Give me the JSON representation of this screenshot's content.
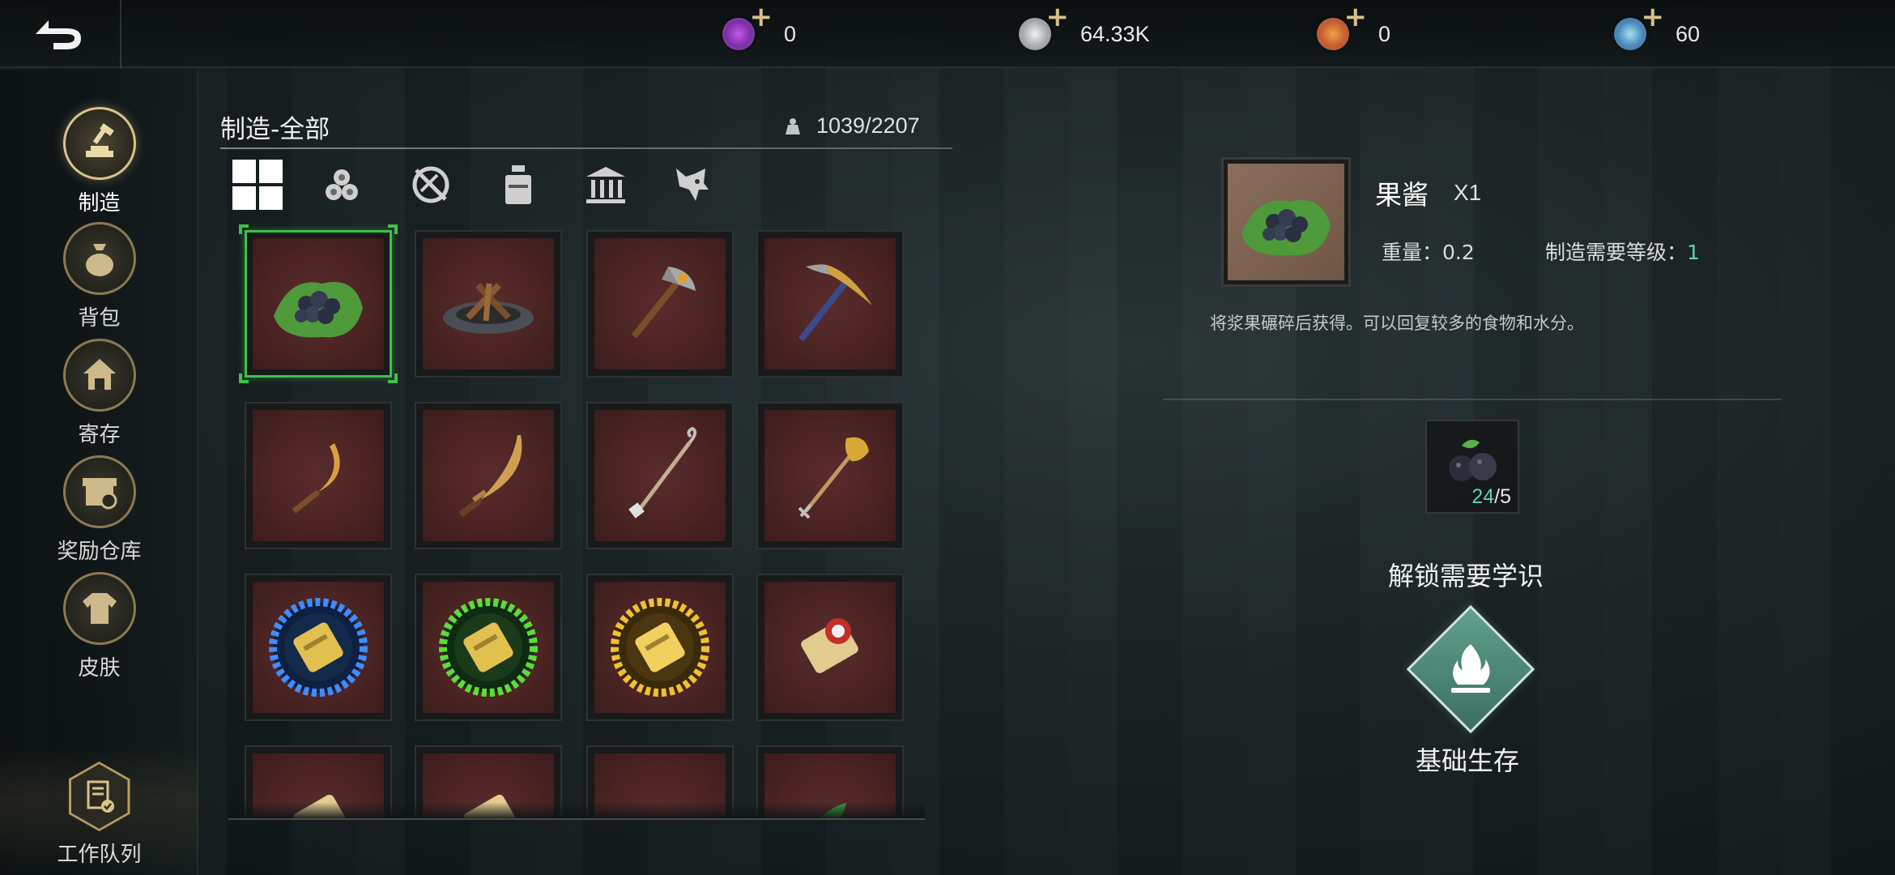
{
  "colors": {
    "accent_gold": "#d8c489",
    "selected_green": "#3bc24a",
    "value_teal": "#5fd1b3",
    "slot_red": "#4a2323"
  },
  "top_bar": {
    "back_icon": "back-arrow-icon",
    "currencies": [
      {
        "icon": "purple-gem-coin-icon",
        "color": "#7b2fb0",
        "amount": "0"
      },
      {
        "icon": "silver-coin-icon",
        "color": "#b9bdc0",
        "amount": "64.33K"
      },
      {
        "icon": "red-gold-coin-icon",
        "color": "#c0552a",
        "amount": "0"
      },
      {
        "icon": "blue-gem-coin-icon",
        "color": "#3f7fb5",
        "amount": "60"
      }
    ]
  },
  "sidebar": {
    "items": [
      {
        "label": "制造",
        "icon": "hammer-anvil-icon",
        "active": true
      },
      {
        "label": "背包",
        "icon": "bag-icon",
        "active": false
      },
      {
        "label": "寄存",
        "icon": "house-storage-icon",
        "active": false
      },
      {
        "label": "奖励仓库",
        "icon": "shop-reward-icon",
        "active": false
      },
      {
        "label": "皮肤",
        "icon": "shirt-skin-icon",
        "active": false
      }
    ],
    "queue": {
      "label": "工作队列",
      "icon": "document-check-icon"
    }
  },
  "crafting": {
    "title": "制造-全部",
    "capacity": "1039/2207",
    "capacity_icon": "weight-icon",
    "categories": [
      {
        "icon": "all-grid-icon",
        "active": true
      },
      {
        "icon": "logs-resource-icon",
        "active": false
      },
      {
        "icon": "tools-crossed-icon",
        "active": false
      },
      {
        "icon": "bottle-consumable-icon",
        "active": false
      },
      {
        "icon": "building-icon",
        "active": false
      },
      {
        "icon": "wolf-creature-icon",
        "active": false
      }
    ],
    "items": [
      {
        "icon": "berry-jam-icon",
        "selected": true
      },
      {
        "icon": "campfire-icon",
        "selected": false
      },
      {
        "icon": "stone-axe-icon",
        "selected": false
      },
      {
        "icon": "pickaxe-icon",
        "selected": false
      },
      {
        "icon": "sickle-icon",
        "selected": false
      },
      {
        "icon": "curved-blade-icon",
        "selected": false
      },
      {
        "icon": "hook-staff-icon",
        "selected": false
      },
      {
        "icon": "shovel-icon",
        "selected": false
      },
      {
        "icon": "blue-rune-scroll-icon",
        "selected": false
      },
      {
        "icon": "green-rune-scroll-icon",
        "selected": false
      },
      {
        "icon": "gold-rune-scroll-icon",
        "selected": false
      },
      {
        "icon": "red-seal-scroll-icon",
        "selected": false
      },
      {
        "icon": "scroll-icon",
        "selected": false
      },
      {
        "icon": "green-seal-scroll-icon",
        "selected": false
      },
      {
        "icon": "gravel-pile-icon",
        "selected": false
      },
      {
        "icon": "herb-leaves-icon",
        "selected": false
      }
    ]
  },
  "detail": {
    "name": "果酱",
    "qty": "X1",
    "weight_label": "重量：",
    "weight_value": "0.2",
    "level_label": "制造需要等级：",
    "level_value": "1",
    "description": "将浆果碾碎后获得。可以回复较多的食物和水分。",
    "material": {
      "icon": "blackberry-icon",
      "have": "24",
      "need": "/5"
    },
    "unlock_title": "解锁需要学识",
    "skill": {
      "name": "基础生存",
      "icon": "campfire-flame-icon"
    }
  }
}
